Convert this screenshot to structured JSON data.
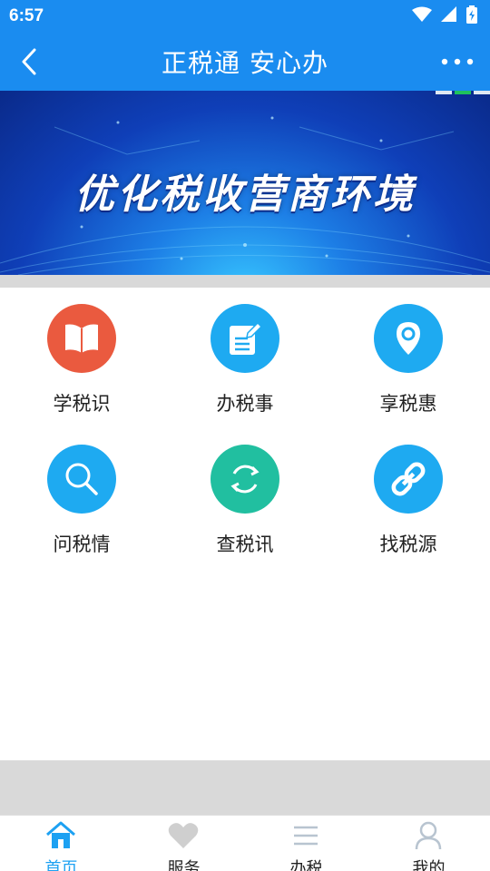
{
  "status_bar": {
    "time": "6:57",
    "icons": [
      "wifi-icon",
      "signal-icon",
      "battery-charging-icon"
    ]
  },
  "header": {
    "title": "正税通 安心办",
    "back_icon": "chevron-left-icon",
    "more_icon": "more-dots-icon"
  },
  "banner": {
    "text": "优化税收营商环境",
    "indicator_active": 2,
    "indicator_count": 3
  },
  "grid": {
    "items": [
      {
        "label": "学税识",
        "icon": "book-icon",
        "color": "#ea5a3f"
      },
      {
        "label": "办税事",
        "icon": "document-pen-icon",
        "color": "#1eaaf1"
      },
      {
        "label": "享税惠",
        "icon": "location-pin-icon",
        "color": "#1eaaf1"
      },
      {
        "label": "问税情",
        "icon": "search-icon",
        "color": "#1eaaf1"
      },
      {
        "label": "查税讯",
        "icon": "refresh-icon",
        "color": "#21bfa0"
      },
      {
        "label": "找税源",
        "icon": "link-icon",
        "color": "#1eaaf1"
      }
    ]
  },
  "tab_bar": {
    "active_index": 0,
    "active_color": "#1da1f2",
    "inactive_color": "#c8c8c8",
    "tabs": [
      {
        "label": "首页",
        "icon": "home-icon"
      },
      {
        "label": "服务",
        "icon": "heart-icon"
      },
      {
        "label": "办税",
        "icon": "menu-lines-icon"
      },
      {
        "label": "我的",
        "icon": "user-icon"
      }
    ]
  },
  "colors": {
    "header_bg": "#1a8cf0",
    "gray_bg": "#d9d9d9"
  }
}
